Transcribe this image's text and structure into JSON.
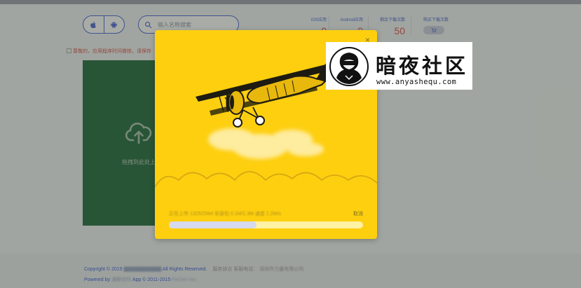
{
  "header": {
    "platforms": [
      {
        "icon": "apple-icon"
      },
      {
        "icon": "android-icon"
      }
    ],
    "search": {
      "placeholder": "输入名称搜索",
      "icon": "search-icon"
    },
    "stats": [
      {
        "label": "iOS应用",
        "value": "0"
      },
      {
        "label": "Android应用",
        "value": "0"
      },
      {
        "label": "剩余下载次数",
        "value": "50"
      }
    ],
    "cart": {
      "label": "购买下载次数",
      "icon": "cart-icon"
    }
  },
  "notice": {
    "text": "尊敬的，应用程序时间做核，请保存"
  },
  "upload": {
    "text": "拖拽到此处上传",
    "icon": "cloud-upload-icon"
  },
  "modal": {
    "progress_text": "正在上传 1325/2584 安装包 0.1M/1.3M 速度 1.2M/s",
    "cancel_label": "取消",
    "progress": 0.45,
    "close_icon": "close-icon"
  },
  "footer": {
    "copyright_prefix": "Copyright © 2015",
    "copyright_suffix": "All Rights Reserved.",
    "links": "服务协议  客服电话：",
    "company": "深圳市力量有限公司",
    "powered_prefix": "Powered by",
    "powered_name": "浦聊信科",
    "powered_mid": "App © 2011-2015",
    "powered_company": "FirCom Inc."
  },
  "watermark": {
    "brand_cn": "暗夜社区",
    "url": "www.anyashequ.com"
  },
  "colors": {
    "accent": "#4a64d6",
    "danger": "#d9534f",
    "modal_bg": "#fdcf0f",
    "upload_bg": "#226a3e"
  }
}
